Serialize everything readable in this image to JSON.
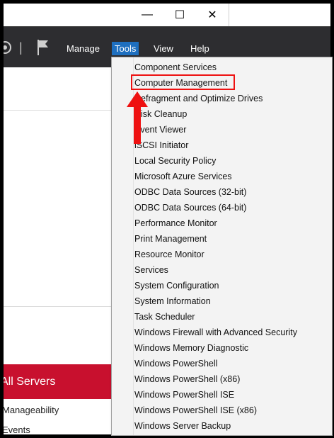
{
  "window": {
    "caption_buttons": {
      "minimize": "—",
      "maximize": "☐",
      "close": "✕"
    }
  },
  "toolbar": {
    "menus": [
      {
        "label": "Manage"
      },
      {
        "label": "Tools"
      },
      {
        "label": "View"
      },
      {
        "label": "Help"
      }
    ],
    "separator": "|"
  },
  "left_pane": {
    "selected_group": "All Servers",
    "items": [
      "Manageability",
      "Events"
    ]
  },
  "tools_menu": {
    "items": [
      "Component Services",
      "Computer Management",
      "Defragment and Optimize Drives",
      "Disk Cleanup",
      "Event Viewer",
      "iSCSI Initiator",
      "Local Security Policy",
      "Microsoft Azure Services",
      "ODBC Data Sources (32-bit)",
      "ODBC Data Sources (64-bit)",
      "Performance Monitor",
      "Print Management",
      "Resource Monitor",
      "Services",
      "System Configuration",
      "System Information",
      "Task Scheduler",
      "Windows Firewall with Advanced Security",
      "Windows Memory Diagnostic",
      "Windows PowerShell",
      "Windows PowerShell (x86)",
      "Windows PowerShell ISE",
      "Windows PowerShell ISE (x86)",
      "Windows Server Backup"
    ],
    "highlighted_item": "Computer Management"
  },
  "annotation": {
    "highlight_color": "#ee1111",
    "arrow_color": "#ee1111"
  },
  "colors": {
    "toolbar_bg": "#2d2d30",
    "tools_menu_active": "#1e6fbf",
    "all_servers_bg": "#c8102e"
  },
  "icons": [
    "refresh-icon",
    "flag-icon",
    "minimize-icon",
    "maximize-icon",
    "close-icon"
  ]
}
